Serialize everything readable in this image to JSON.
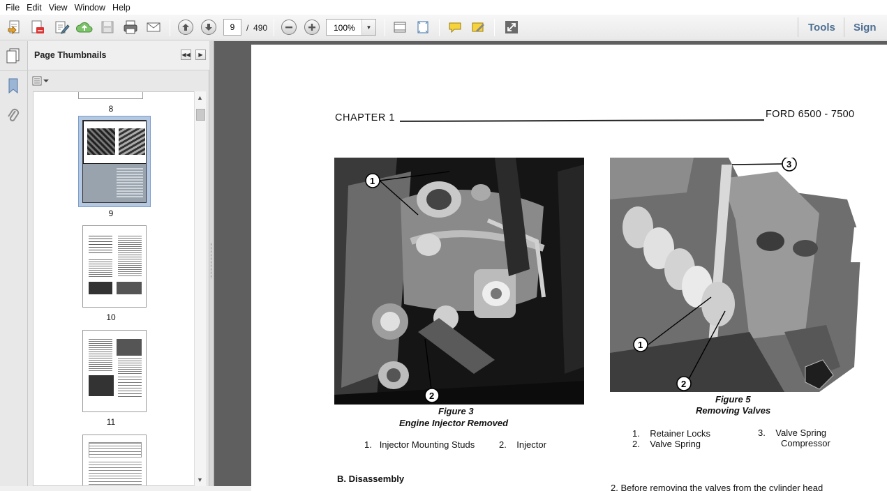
{
  "menu": [
    "File",
    "Edit",
    "View",
    "Window",
    "Help"
  ],
  "toolbar": {
    "page_current": "9",
    "page_sep": "/",
    "page_total": "490",
    "zoom": "100%",
    "tools_label": "Tools",
    "sign_label": "Sign"
  },
  "panel": {
    "title": "Page Thumbnails",
    "thumbnails": [
      {
        "label": "8"
      },
      {
        "label": "9",
        "selected": true
      },
      {
        "label": "10"
      },
      {
        "label": "11"
      }
    ]
  },
  "document": {
    "chapter": "CHAPTER 1",
    "model": "FORD 6500 -  7500",
    "figure3": {
      "caption_num": "Figure 3",
      "caption_title": "Engine Injector Removed",
      "callout_1": "1",
      "callout_2": "2",
      "legend": [
        {
          "num": "1.",
          "text": "Injector Mounting Studs"
        },
        {
          "num": "2.",
          "text": "Injector"
        }
      ]
    },
    "figure5": {
      "caption_num": "Figure 5",
      "caption_title": "Removing Valves",
      "callout_1": "1",
      "callout_2": "2",
      "callout_3": "3",
      "legend": [
        {
          "num": "1.",
          "text": "Retainer Locks"
        },
        {
          "num": "2.",
          "text": "Valve Spring"
        },
        {
          "num": "3.",
          "text": "Valve Spring"
        },
        {
          "num": "",
          "text": "Compressor"
        }
      ]
    },
    "section_heading": "B. Disassembly",
    "cut_text": "2.   Before removing the valves from the cylinder head"
  }
}
